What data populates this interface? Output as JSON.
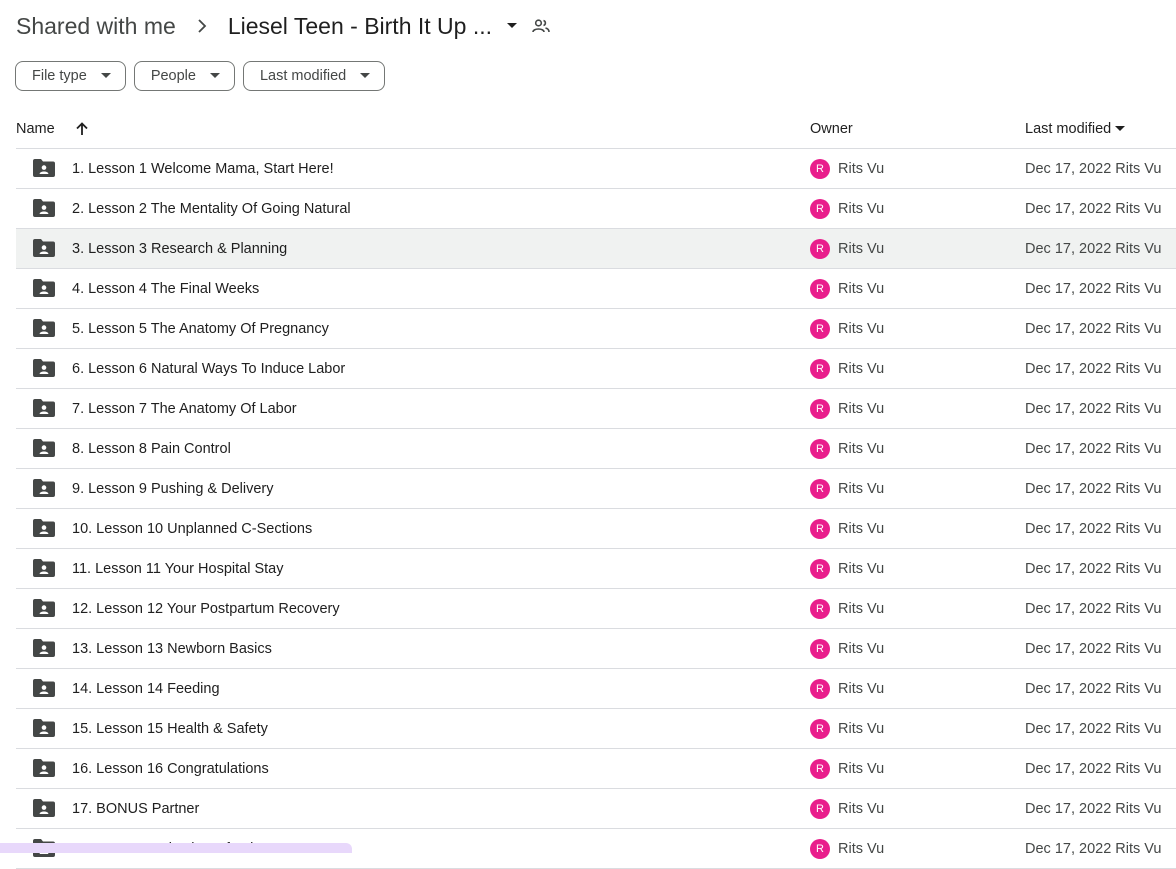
{
  "breadcrumb": {
    "root": "Shared with me",
    "current": "Liesel Teen - Birth It Up ..."
  },
  "filters": {
    "file_type": "File type",
    "people": "People",
    "last_modified": "Last modified"
  },
  "columns": {
    "name": "Name",
    "owner": "Owner",
    "last_modified": "Last modified"
  },
  "rows": [
    {
      "name": "1. Lesson 1 Welcome Mama, Start Here!",
      "owner": "Rits Vu",
      "initial": "R",
      "modified": "Dec 17, 2022 Rits Vu"
    },
    {
      "name": "2. Lesson 2 The Mentality Of Going Natural",
      "owner": "Rits Vu",
      "initial": "R",
      "modified": "Dec 17, 2022 Rits Vu"
    },
    {
      "name": "3. Lesson 3 Research & Planning",
      "owner": "Rits Vu",
      "initial": "R",
      "modified": "Dec 17, 2022 Rits Vu"
    },
    {
      "name": "4. Lesson 4 The Final Weeks",
      "owner": "Rits Vu",
      "initial": "R",
      "modified": "Dec 17, 2022 Rits Vu"
    },
    {
      "name": "5. Lesson 5 The Anatomy Of Pregnancy",
      "owner": "Rits Vu",
      "initial": "R",
      "modified": "Dec 17, 2022 Rits Vu"
    },
    {
      "name": "6. Lesson 6 Natural Ways To Induce Labor",
      "owner": "Rits Vu",
      "initial": "R",
      "modified": "Dec 17, 2022 Rits Vu"
    },
    {
      "name": "7. Lesson 7 The Anatomy Of Labor",
      "owner": "Rits Vu",
      "initial": "R",
      "modified": "Dec 17, 2022 Rits Vu"
    },
    {
      "name": "8. Lesson 8 Pain Control",
      "owner": "Rits Vu",
      "initial": "R",
      "modified": "Dec 17, 2022 Rits Vu"
    },
    {
      "name": "9. Lesson 9 Pushing & Delivery",
      "owner": "Rits Vu",
      "initial": "R",
      "modified": "Dec 17, 2022 Rits Vu"
    },
    {
      "name": "10. Lesson 10 Unplanned C-Sections",
      "owner": "Rits Vu",
      "initial": "R",
      "modified": "Dec 17, 2022 Rits Vu"
    },
    {
      "name": "11. Lesson 11 Your Hospital Stay",
      "owner": "Rits Vu",
      "initial": "R",
      "modified": "Dec 17, 2022 Rits Vu"
    },
    {
      "name": "12. Lesson 12 Your Postpartum Recovery",
      "owner": "Rits Vu",
      "initial": "R",
      "modified": "Dec 17, 2022 Rits Vu"
    },
    {
      "name": "13. Lesson 13 Newborn Basics",
      "owner": "Rits Vu",
      "initial": "R",
      "modified": "Dec 17, 2022 Rits Vu"
    },
    {
      "name": "14. Lesson 14 Feeding",
      "owner": "Rits Vu",
      "initial": "R",
      "modified": "Dec 17, 2022 Rits Vu"
    },
    {
      "name": "15. Lesson 15 Health & Safety",
      "owner": "Rits Vu",
      "initial": "R",
      "modified": "Dec 17, 2022 Rits Vu"
    },
    {
      "name": "16. Lesson 16 Congratulations",
      "owner": "Rits Vu",
      "initial": "R",
      "modified": "Dec 17, 2022 Rits Vu"
    },
    {
      "name": "17. BONUS Partner",
      "owner": "Rits Vu",
      "initial": "R",
      "modified": "Dec 17, 2022 Rits Vu"
    },
    {
      "name": "18. BONUS Induction Of Labor",
      "owner": "Rits Vu",
      "initial": "R",
      "modified": "Dec 17, 2022 Rits Vu"
    }
  ],
  "highlighted_row": 3,
  "colors": {
    "avatar": "#e91e8c",
    "row_highlight": "#f0f2f1",
    "folder_icon": "#444746"
  },
  "icons": {
    "breadcrumb_separator": "chevron-right-icon",
    "breadcrumb_menu": "caret-down-icon",
    "shared": "people-icon",
    "sort": "arrow-up-icon",
    "folder": "shared-folder-icon"
  }
}
